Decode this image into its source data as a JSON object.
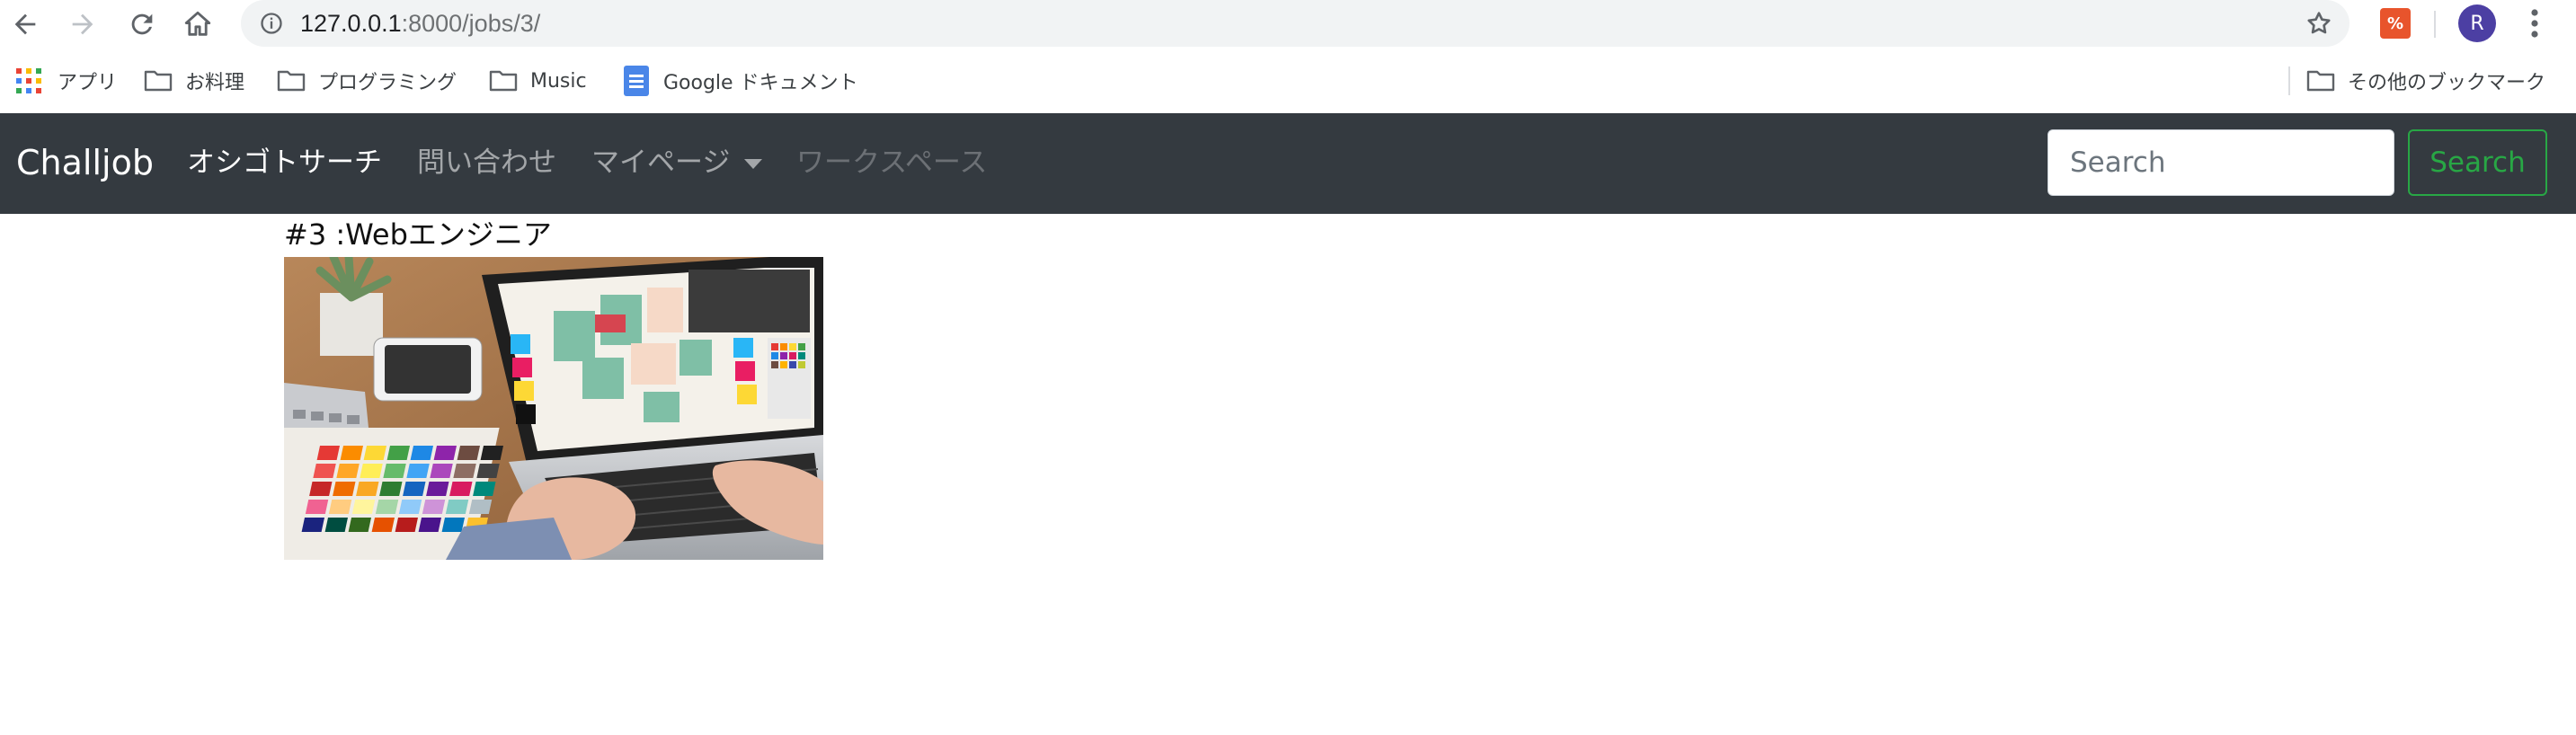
{
  "browser": {
    "url_host": "127.0.0.1",
    "url_path": ":8000/jobs/3/",
    "avatar_letter": "R",
    "extension_label": "%"
  },
  "bookmarks": {
    "items": [
      {
        "label": "アプリ",
        "icon": "apps-grid-icon"
      },
      {
        "label": "お料理",
        "icon": "folder-icon"
      },
      {
        "label": "プログラミング",
        "icon": "folder-icon"
      },
      {
        "label": "Music",
        "icon": "folder-icon"
      },
      {
        "label": "Google ドキュメント",
        "icon": "google-docs-icon"
      }
    ],
    "other": "その他のブックマーク"
  },
  "navbar": {
    "brand": "Challjob",
    "links": [
      {
        "label": "オシゴトサーチ",
        "state": "active"
      },
      {
        "label": "問い合わせ",
        "state": "normal"
      },
      {
        "label": "マイページ",
        "state": "dropdown"
      },
      {
        "label": "ワークスペース",
        "state": "disabled"
      }
    ],
    "search_placeholder": "Search",
    "search_button": "Search"
  },
  "job": {
    "title": "#3 :Webエンジニア",
    "image_description": "laptop with design software and color swatches",
    "image_icon": "laptop-photo"
  },
  "colors": {
    "navbar_bg": "#343a40",
    "search_button": "#28a745"
  }
}
